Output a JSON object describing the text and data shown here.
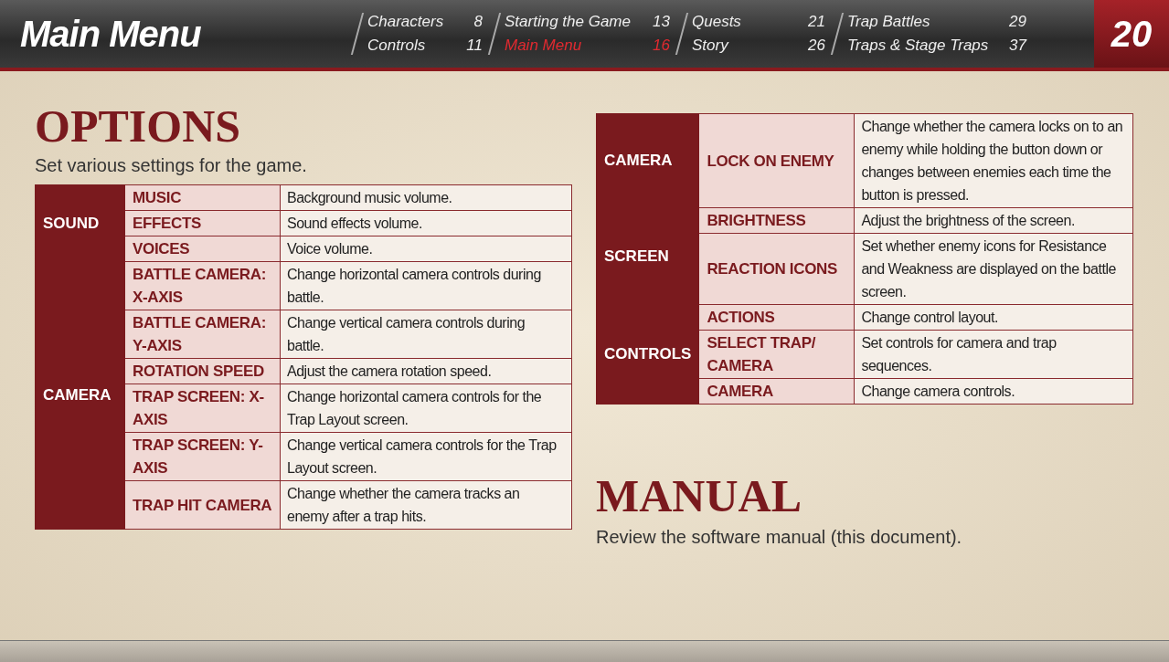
{
  "header": {
    "title": "Main Menu",
    "nav": [
      {
        "label": "Characters",
        "page": "8",
        "selected": false
      },
      {
        "label": "Controls",
        "page": "11",
        "selected": false
      },
      {
        "label": "Starting the Game",
        "page": "13",
        "selected": false
      },
      {
        "label": "Main Menu",
        "page": "16",
        "selected": true
      },
      {
        "label": "Quests",
        "page": "21",
        "selected": false
      },
      {
        "label": "Story",
        "page": "26",
        "selected": false
      },
      {
        "label": "Trap Battles",
        "page": "29",
        "selected": false
      },
      {
        "label": "Traps & Stage Traps",
        "page": "37",
        "selected": false
      }
    ],
    "page_number": "20"
  },
  "options": {
    "title": "OPTIONS",
    "subtitle": "Set various settings for the game.",
    "groups": [
      {
        "name": "SOUND",
        "rows": [
          {
            "setting": "MUSIC",
            "description": "Background music volume."
          },
          {
            "setting": "EFFECTS",
            "description": "Sound effects volume."
          },
          {
            "setting": "VOICES",
            "description": "Voice volume."
          }
        ]
      },
      {
        "name": "CAMERA",
        "rows": [
          {
            "setting": "BATTLE CAMERA: X-AXIS",
            "description": "Change horizontal camera controls during battle."
          },
          {
            "setting": "BATTLE CAMERA: Y-AXIS",
            "description": "Change vertical camera controls during battle."
          },
          {
            "setting": "ROTATION SPEED",
            "description": "Adjust the camera rotation speed."
          },
          {
            "setting": "TRAP SCREEN: X-AXIS",
            "description": "Change horizontal camera controls for the Trap Layout screen."
          },
          {
            "setting": "TRAP SCREEN: Y-AXIS",
            "description": "Change vertical camera controls for the Trap Layout screen."
          },
          {
            "setting": "TRAP HIT CAMERA",
            "description": "Change whether the camera tracks an enemy after a trap hits."
          }
        ]
      }
    ]
  },
  "options_continued": {
    "groups": [
      {
        "name": "CAMERA",
        "rows": [
          {
            "setting": "LOCK ON ENEMY",
            "description": "Change whether the camera locks on to an enemy while holding the button down or changes between enemies each time the button is pressed."
          }
        ]
      },
      {
        "name": "SCREEN",
        "rows": [
          {
            "setting": "BRIGHTNESS",
            "description": "Adjust the brightness of the screen."
          },
          {
            "setting": "REACTION ICONS",
            "description": "Set whether enemy icons for Resistance and Weakness are displayed on the battle screen."
          }
        ]
      },
      {
        "name": "CONTROLS",
        "rows": [
          {
            "setting": "ACTIONS",
            "description": "Change control layout."
          },
          {
            "setting": "SELECT TRAP/ CAMERA",
            "description": "Set controls for camera and trap sequences."
          },
          {
            "setting": "CAMERA",
            "description": "Change camera controls."
          }
        ]
      }
    ]
  },
  "manual": {
    "title": "MANUAL",
    "description": "Review the software manual (this document)."
  }
}
